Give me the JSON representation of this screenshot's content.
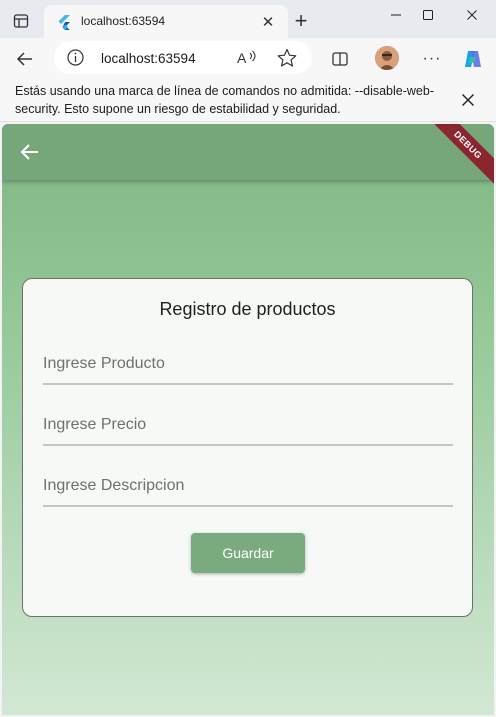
{
  "browser": {
    "tab_title": "localhost:63594",
    "url": "localhost:63594",
    "icons": {
      "tab_actions": "tab-actions-icon",
      "favicon": "flutter-icon",
      "tab_close": "close-icon",
      "new_tab": "plus-icon",
      "back": "back-arrow-icon",
      "info": "info-icon",
      "read_aloud": "read-aloud-icon",
      "favorite": "star-icon",
      "split": "split-screen-icon",
      "profile": "avatar-icon",
      "more": "more-icon",
      "copilot": "copilot-icon"
    }
  },
  "infobar": {
    "message": "Estás usando una marca de línea de comandos no admitida: --disable-web-security. Esto supone un riesgo de estabilidad y seguridad."
  },
  "app": {
    "debug_banner": "DEBUG",
    "form": {
      "title": "Registro de productos",
      "product_placeholder": "Ingrese Producto",
      "price_placeholder": "Ingrese Precio",
      "description_placeholder": "Ingrese Descripcion",
      "save_label": "Guardar"
    },
    "colors": {
      "appbar": "#76a67a",
      "button": "#7aab7e",
      "debug": "#8b2630"
    }
  }
}
